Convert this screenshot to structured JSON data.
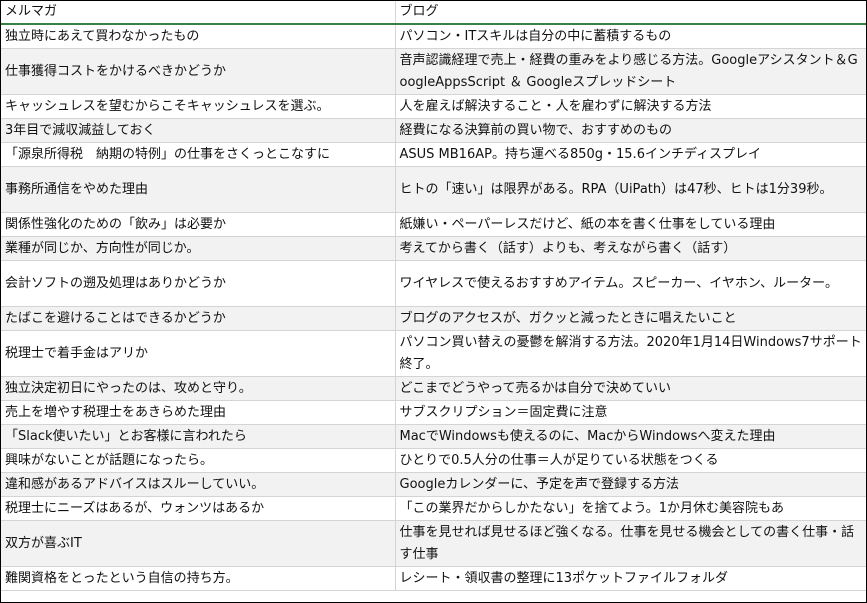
{
  "headers": [
    "メルマガ",
    "ブログ"
  ],
  "rows": [
    [
      "独立時にあえて買わなかったもの",
      "パソコン・ITスキルは自分の中に蓄積するもの"
    ],
    [
      "仕事獲得コストをかけるべきかどうか",
      "音声認識経理で売上・経費の重みをより感じる方法。Googleアシスタント＆GoogleAppsScript ＆ Googleスプレッドシート"
    ],
    [
      "キャッシュレスを望むからこそキャッシュレスを選ぶ。",
      "人を雇えば解決すること・人を雇わずに解決する方法"
    ],
    [
      "3年目で減収減益しておく",
      "経費になる決算前の買い物で、おすすめのもの"
    ],
    [
      "「源泉所得税　納期の特例」の仕事をさくっとこなすに",
      "ASUS MB16AP。持ち運べる850g・15.6インチディスプレイ"
    ],
    [
      "事務所通信をやめた理由",
      "ヒトの「速い」は限界がある。RPA（UiPath）は47秒、ヒトは1分39秒。"
    ],
    [
      "関係性強化のための「飲み」は必要か",
      "紙嫌い・ペーパーレスだけど、紙の本を書く仕事をしている理由"
    ],
    [
      "業種が同じか、方向性が同じか。",
      "考えてから書く（話す）よりも、考えながら書く（話す）"
    ],
    [
      "会計ソフトの遡及処理はありかどうか",
      "ワイヤレスで使えるおすすめアイテム。スピーカー、イヤホン、ルーター。"
    ],
    [
      "たばこを避けることはできるかどうか",
      "ブログのアクセスが、ガクッと減ったときに唱えたいこと"
    ],
    [
      "税理士で着手金はアリか",
      "パソコン買い替えの憂鬱を解消する方法。2020年1月14日Windows7サポート終了。"
    ],
    [
      "独立決定初日にやったのは、攻めと守り。",
      "どこまでどうやって売るかは自分で決めていい"
    ],
    [
      "売上を増やす税理士をあきらめた理由",
      "サブスクリプション＝固定費に注意"
    ],
    [
      "「Slack使いたい」とお客様に言われたら",
      "MacでWindowsも使えるのに、MacからWindowsへ変えた理由"
    ],
    [
      "興味がないことが話題になったら。",
      "ひとりで0.5人分の仕事＝人が足りている状態をつくる"
    ],
    [
      "違和感があるアドバイスはスルーしていい。",
      "Googleカレンダーに、予定を声で登録する方法"
    ],
    [
      "税理士にニーズはあるが、ウォンツはあるか",
      "「この業界だからしかたない」を捨てよう。1か月休む美容院もあ"
    ],
    [
      "双方が喜ぶIT",
      "仕事を見せれば見せるほど強くなる。仕事を見せる機会としての書く仕事・話す仕事"
    ],
    [
      "難関資格をとったという自信の持ち方。",
      "レシート・領収書の整理に13ポケットファイルフォルダ"
    ]
  ]
}
